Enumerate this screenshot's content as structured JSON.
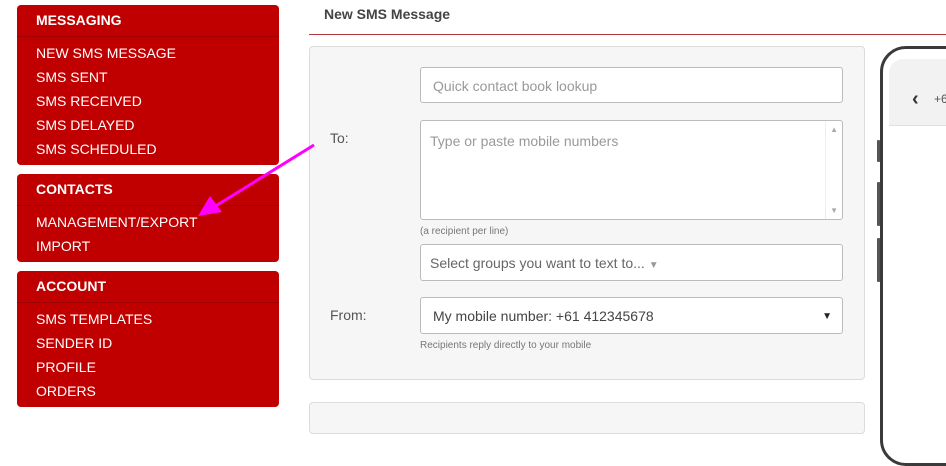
{
  "sidebar": {
    "messaging": {
      "title": "MESSAGING",
      "items": [
        "NEW SMS MESSAGE",
        "SMS SENT",
        "SMS RECEIVED",
        "SMS DELAYED",
        "SMS SCHEDULED"
      ]
    },
    "contacts": {
      "title": "CONTACTS",
      "items": [
        "MANAGEMENT/EXPORT",
        "IMPORT"
      ]
    },
    "account": {
      "title": "ACCOUNT",
      "items": [
        "SMS TEMPLATES",
        "SENDER ID",
        "PROFILE",
        "ORDERS"
      ]
    }
  },
  "header": {
    "title": "New SMS Message"
  },
  "form": {
    "lookup_placeholder": "Quick contact book lookup",
    "to_label": "To:",
    "numbers_placeholder": "Type or paste mobile numbers",
    "numbers_hint": "(a recipient per line)",
    "groups_placeholder": "Select groups you want to text to...",
    "from_label": "From:",
    "from_value": "My mobile number: +61 412345678",
    "from_hint": "Recipients reply directly to your mobile"
  },
  "phone": {
    "number_partial": "+6"
  },
  "colors": {
    "brand": "#c00000",
    "annotation_arrow": "#ff00ff"
  }
}
